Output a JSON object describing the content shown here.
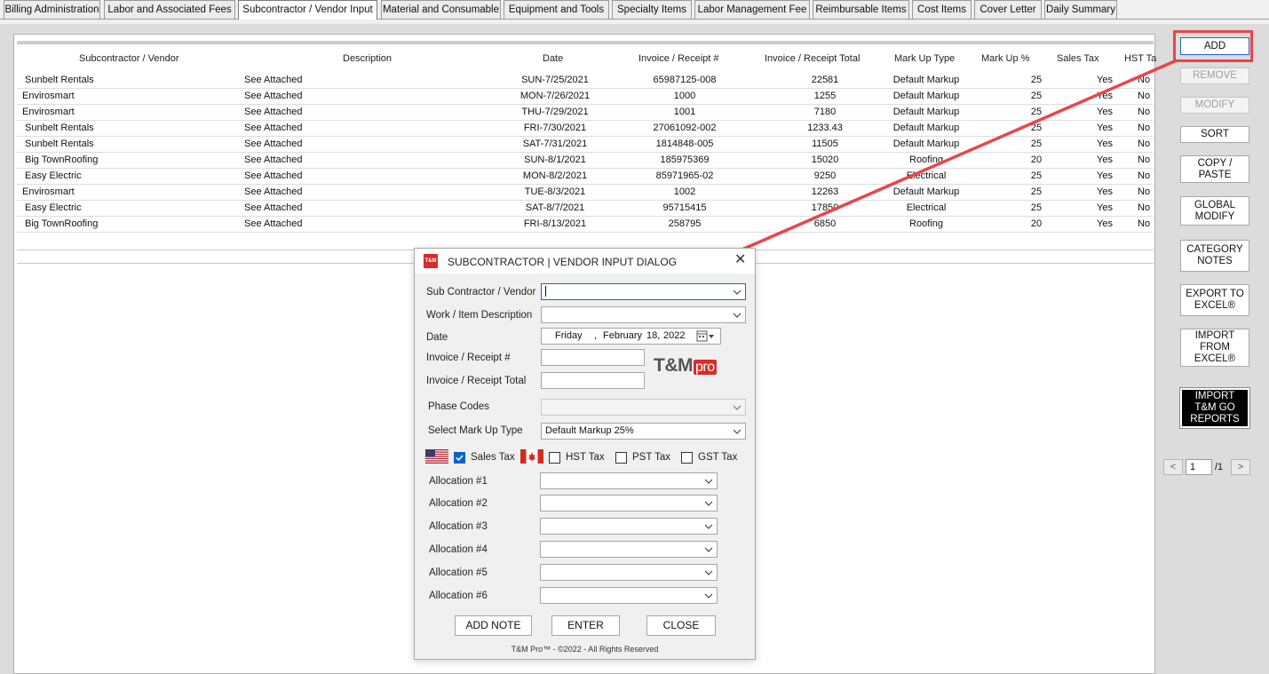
{
  "tabs": [
    {
      "label": "Billing Administration"
    },
    {
      "label": "Labor and Associated Fees"
    },
    {
      "label": "Subcontractor / Vendor Input"
    },
    {
      "label": "Material and Consumable"
    },
    {
      "label": "Equipment and Tools"
    },
    {
      "label": "Specialty Items"
    },
    {
      "label": "Labor Management Fee"
    },
    {
      "label": "Reimbursable Items"
    },
    {
      "label": "Cost Items"
    },
    {
      "label": "Cover Letter"
    },
    {
      "label": "Daily Summary"
    }
  ],
  "active_tab": "Subcontractor / Vendor Input",
  "table": {
    "headers": [
      "Subcontractor / Vendor",
      "Description",
      "Date",
      "Invoice / Receipt #",
      "Invoice / Receipt Total",
      "Mark Up Type",
      "Mark Up %",
      "Sales Tax",
      "HST Ta"
    ],
    "rows": [
      [
        "Sunbelt Rentals",
        "See Attached",
        "SUN-7/25/2021",
        "65987125-008",
        "22581",
        "Default Markup",
        "25",
        "Yes",
        "No"
      ],
      [
        "Envirosmart",
        "See Attached",
        "MON-7/26/2021",
        "1000",
        "1255",
        "Default Markup",
        "25",
        "Yes",
        "No"
      ],
      [
        "Envirosmart",
        "See Attached",
        "THU-7/29/2021",
        "1001",
        "7180",
        "Default Markup",
        "25",
        "Yes",
        "No"
      ],
      [
        "Sunbelt Rentals",
        "See Attached",
        "FRI-7/30/2021",
        "27061092-002",
        "1233.43",
        "Default Markup",
        "25",
        "Yes",
        "No"
      ],
      [
        "Sunbelt Rentals",
        "See Attached",
        "SAT-7/31/2021",
        "1814848-005",
        "11505",
        "Default Markup",
        "25",
        "Yes",
        "No"
      ],
      [
        "Big TownRoofing",
        "See Attached",
        "SUN-8/1/2021",
        "185975369",
        "15020",
        "Roofing",
        "20",
        "Yes",
        "No"
      ],
      [
        "Easy Electric",
        "See Attached",
        "MON-8/2/2021",
        "85971965-02",
        "9250",
        "Electrical",
        "25",
        "Yes",
        "No"
      ],
      [
        "Envirosmart",
        "See Attached",
        "TUE-8/3/2021",
        "1002",
        "12263",
        "Default Markup",
        "25",
        "Yes",
        "No"
      ],
      [
        "Easy Electric",
        "See Attached",
        "SAT-8/7/2021",
        "95715415",
        "17850",
        "Electrical",
        "25",
        "Yes",
        "No"
      ],
      [
        "Big TownRoofing",
        "See Attached",
        "FRI-8/13/2021",
        "258795",
        "6850",
        "Roofing",
        "20",
        "Yes",
        "No"
      ]
    ]
  },
  "sidebar": {
    "add": "ADD",
    "remove": "REMOVE",
    "modify": "MODIFY",
    "sort": "SORT",
    "copy_paste": [
      "COPY /",
      "PASTE"
    ],
    "global_modify": [
      "GLOBAL",
      "MODIFY"
    ],
    "category_notes": [
      "CATEGORY",
      "NOTES"
    ],
    "export_excel": [
      "EXPORT TO",
      "EXCEL®"
    ],
    "import_excel": [
      "IMPORT",
      "FROM",
      "EXCEL®"
    ],
    "import_tmgo": [
      "IMPORT",
      "T&M GO",
      "REPORTS"
    ]
  },
  "pager": {
    "prev": "<",
    "next": ">",
    "current": "1",
    "total": "/1"
  },
  "dialog": {
    "logo": "T&M",
    "title": "SUBCONTRACTOR | VENDOR INPUT DIALOG",
    "close_glyph": "✕",
    "labels": {
      "vendor": "Sub Contractor / Vendor",
      "description": "Work / Item Description",
      "date": "Date",
      "invoice_no": "Invoice / Receipt #",
      "invoice_total": "Invoice / Receipt Total",
      "phase_codes": "Phase Codes",
      "markup_type": "Select Mark Up Type",
      "sales_tax": "Sales Tax",
      "hst_tax": "HST Tax",
      "pst_tax": "PST Tax",
      "gst_tax": "GST Tax"
    },
    "date_value": {
      "weekday": "Friday",
      "sep": ",",
      "month": "February",
      "day": "18,",
      "year": "2022"
    },
    "markup_value": "Default Markup 25%",
    "taxes": {
      "sales": true,
      "hst": false,
      "pst": false,
      "gst": false
    },
    "allocations": [
      "Allocation #1",
      "Allocation #2",
      "Allocation #3",
      "Allocation #4",
      "Allocation #5",
      "Allocation #6"
    ],
    "buttons": {
      "add_note": "ADD NOTE",
      "enter": "ENTER",
      "close": "CLOSE"
    },
    "brand": {
      "main": "T&M",
      "pro": "pro"
    },
    "copyright": "T&M Pro™ - ©2022 - All Rights Reserved"
  },
  "colors": {
    "accent": "#1c63c8",
    "highlight": "#e8464a",
    "brand_red": "#d92b2b"
  }
}
